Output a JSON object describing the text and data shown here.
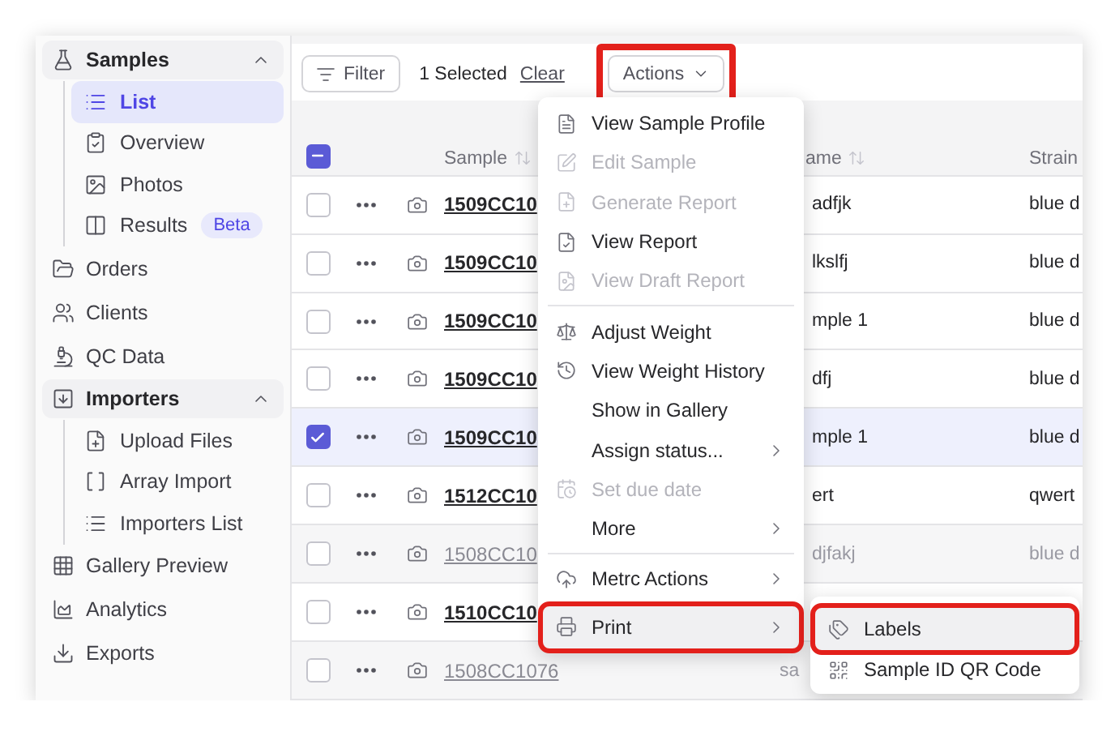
{
  "sidebar": {
    "groups": [
      {
        "label": "Samples",
        "expanded": true,
        "children": [
          {
            "label": "List",
            "selected": true
          },
          {
            "label": "Overview",
            "selected": false
          },
          {
            "label": "Photos",
            "selected": false
          },
          {
            "label": "Results",
            "selected": false,
            "badge": "Beta"
          }
        ]
      },
      {
        "label": "Orders"
      },
      {
        "label": "Clients"
      },
      {
        "label": "QC Data"
      },
      {
        "label": "Importers",
        "expanded": true,
        "children": [
          {
            "label": "Upload Files",
            "selected": false
          },
          {
            "label": "Array Import",
            "selected": false
          },
          {
            "label": "Importers List",
            "selected": false
          }
        ]
      },
      {
        "label": "Gallery Preview"
      },
      {
        "label": "Analytics"
      },
      {
        "label": "Exports"
      }
    ]
  },
  "toolbar": {
    "filter": "Filter",
    "selection": "1 Selected",
    "clear": "Clear",
    "actions": {
      "label": "Actions",
      "highlighted": true
    }
  },
  "table": {
    "columns": [
      "Sample",
      "ame",
      "Strain"
    ],
    "select_all": {
      "indeterminate": true
    },
    "rows": [
      {
        "sample": "1509CC10",
        "name": "adfjk",
        "strain": "blue d",
        "selected": false,
        "muted": false
      },
      {
        "sample": "1509CC10",
        "name": "lkslfj",
        "strain": "blue d",
        "selected": false,
        "muted": false
      },
      {
        "sample": "1509CC10",
        "name": "mple 1",
        "strain": "blue d",
        "selected": false,
        "muted": false
      },
      {
        "sample": "1509CC10",
        "name": "dfj",
        "strain": "blue d",
        "selected": false,
        "muted": false
      },
      {
        "sample": "1509CC10",
        "name": "mple 1",
        "strain": "blue d",
        "selected": true,
        "muted": false
      },
      {
        "sample": "1512CC10",
        "name": "ert",
        "strain": "qwert",
        "selected": false,
        "muted": false
      },
      {
        "sample": "1508CC10",
        "name": "djfakj",
        "strain": "blue d",
        "selected": false,
        "muted": true
      },
      {
        "sample": "1510CC10",
        "selected": false,
        "muted": false
      },
      {
        "sample": "1508CC1076",
        "name": "sa",
        "selected": false,
        "muted": true
      }
    ]
  },
  "menu": {
    "items": [
      {
        "kind": "item",
        "label": "View Sample Profile",
        "disabled": false,
        "submenu": false,
        "highlighted": false
      },
      {
        "kind": "item",
        "label": "Edit Sample",
        "disabled": true,
        "submenu": false,
        "highlighted": false
      },
      {
        "kind": "item",
        "label": "Generate Report",
        "disabled": true,
        "submenu": false,
        "highlighted": false
      },
      {
        "kind": "item",
        "label": "View Report",
        "disabled": false,
        "submenu": false,
        "highlighted": false
      },
      {
        "kind": "item",
        "label": "View Draft Report",
        "disabled": true,
        "submenu": false,
        "highlighted": false
      },
      {
        "kind": "divider"
      },
      {
        "kind": "item",
        "label": "Adjust Weight",
        "disabled": false,
        "submenu": false,
        "highlighted": false
      },
      {
        "kind": "item",
        "label": "View Weight History",
        "disabled": false,
        "submenu": false,
        "highlighted": false
      },
      {
        "kind": "item",
        "label": "Show in Gallery",
        "disabled": false,
        "submenu": false,
        "highlighted": false
      },
      {
        "kind": "item",
        "label": "Assign status...",
        "disabled": false,
        "submenu": true,
        "highlighted": false
      },
      {
        "kind": "item",
        "label": "Set due date",
        "disabled": true,
        "submenu": false,
        "highlighted": false
      },
      {
        "kind": "item",
        "label": "More",
        "disabled": false,
        "submenu": true,
        "highlighted": false
      },
      {
        "kind": "divider"
      },
      {
        "kind": "item",
        "label": "Metrc Actions",
        "disabled": false,
        "submenu": true,
        "highlighted": false
      },
      {
        "kind": "item",
        "label": "Print",
        "disabled": false,
        "submenu": true,
        "highlighted": true
      }
    ],
    "submenu": [
      {
        "label": "Labels",
        "highlighted": true
      },
      {
        "label": "Sample ID QR Code",
        "highlighted": false
      }
    ]
  }
}
